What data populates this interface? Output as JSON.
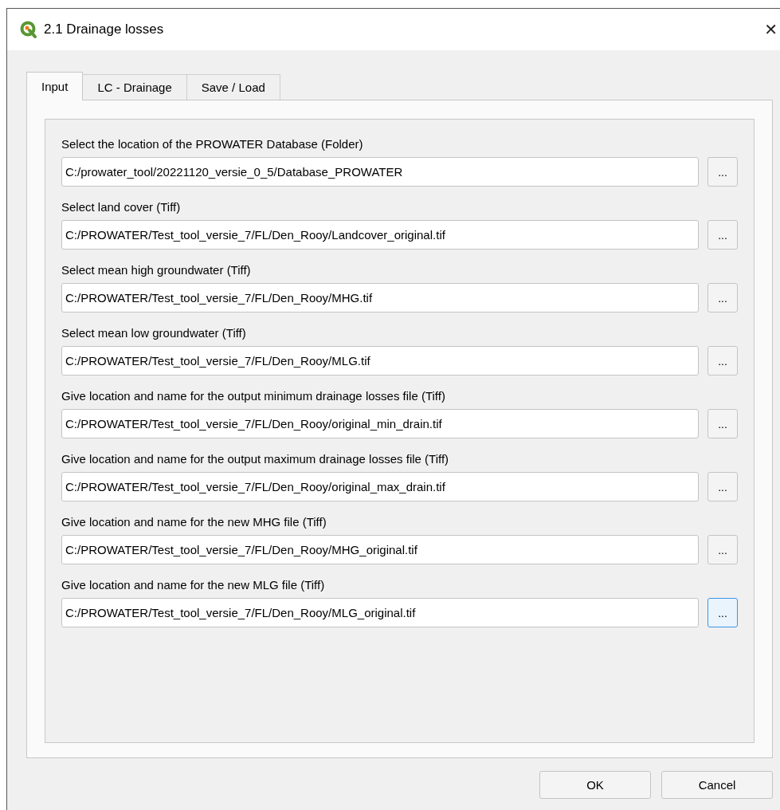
{
  "window": {
    "title": "2.1 Drainage losses",
    "close": "✕"
  },
  "tabs": [
    {
      "label": "Input",
      "selected": true
    },
    {
      "label": "LC - Drainage",
      "selected": false
    },
    {
      "label": "Save / Load",
      "selected": false
    }
  ],
  "rows": [
    {
      "label": "Select the location of the PROWATER Database (Folder)",
      "value": "C:/prowater_tool/20221120_versie_0_5/Database_PROWATER",
      "browse": "...",
      "focused": false
    },
    {
      "label": "Select land cover (Tiff)",
      "value": "C:/PROWATER/Test_tool_versie_7/FL/Den_Rooy/Landcover_original.tif",
      "browse": "...",
      "focused": false
    },
    {
      "label": "Select mean high groundwater (Tiff)",
      "value": "C:/PROWATER/Test_tool_versie_7/FL/Den_Rooy/MHG.tif",
      "browse": "...",
      "focused": false
    },
    {
      "label": "Select mean low groundwater (Tiff)",
      "value": "C:/PROWATER/Test_tool_versie_7/FL/Den_Rooy/MLG.tif",
      "browse": "...",
      "focused": false
    },
    {
      "label": "Give location and name for the output minimum drainage losses file (Tiff)",
      "value": "C:/PROWATER/Test_tool_versie_7/FL/Den_Rooy/original_min_drain.tif",
      "browse": "...",
      "focused": false
    },
    {
      "label": "Give location and name for the output maximum drainage losses file (Tiff)",
      "value": "C:/PROWATER/Test_tool_versie_7/FL/Den_Rooy/original_max_drain.tif",
      "browse": "...",
      "focused": false
    },
    {
      "label": "Give location and name for the new MHG file (Tiff)",
      "value": "C:/PROWATER/Test_tool_versie_7/FL/Den_Rooy/MHG_original.tif",
      "browse": "...",
      "focused": false
    },
    {
      "label": "Give location and name for the new MLG file (Tiff)",
      "value": "C:/PROWATER/Test_tool_versie_7/FL/Den_Rooy/MLG_original.tif",
      "browse": "...",
      "focused": true
    }
  ],
  "buttons": [
    "OK",
    "Cancel"
  ]
}
